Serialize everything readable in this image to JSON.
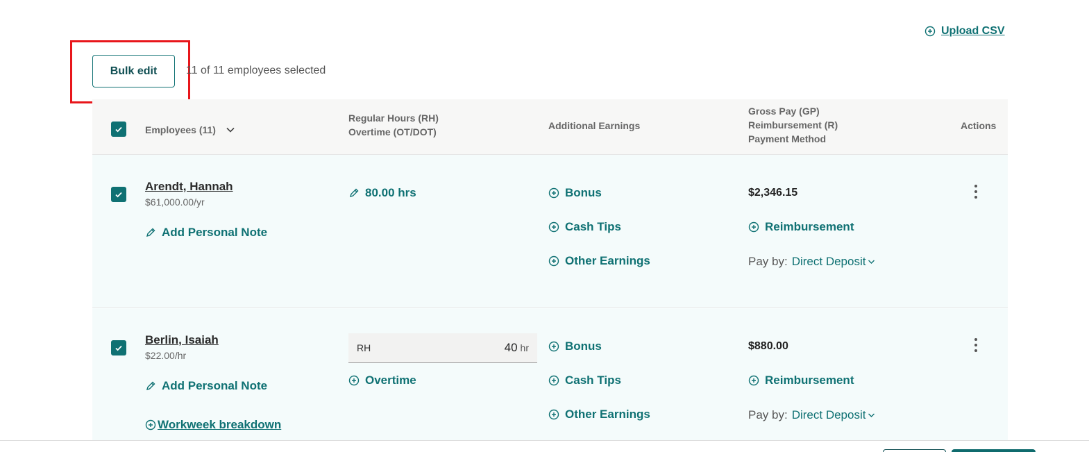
{
  "toolbar": {
    "upload_csv_label": "Upload CSV",
    "bulk_edit_label": "Bulk edit",
    "selection_text": "11 of 11 employees selected"
  },
  "table": {
    "headers": {
      "employees": "Employees (11)",
      "hours_line1": "Regular Hours (RH)",
      "hours_line2": "Overtime (OT/DOT)",
      "additional_earnings": "Additional Earnings",
      "pay_line1": "Gross Pay (GP)",
      "pay_line2": "Reimbursement (R)",
      "pay_line3": "Payment Method",
      "actions": "Actions"
    },
    "rows": [
      {
        "name": "Arendt, Hannah",
        "rate": "$61,000.00/yr",
        "add_note_label": "Add Personal Note",
        "hours_label": "80.00 hrs",
        "earnings": [
          "Bonus",
          "Cash Tips",
          "Other Earnings"
        ],
        "gross_pay": "$2,346.15",
        "reimbursement_label": "Reimbursement",
        "pay_by_label": "Pay by:",
        "payment_method": "Direct Deposit"
      },
      {
        "name": "Berlin, Isaiah",
        "rate": "$22.00/hr",
        "add_note_label": "Add Personal Note",
        "workweek_label": "Workweek breakdown",
        "rh_label": "RH",
        "rh_value": "40",
        "rh_unit": "hr",
        "overtime_label": "Overtime",
        "earnings": [
          "Bonus",
          "Cash Tips",
          "Other Earnings"
        ],
        "gross_pay": "$880.00",
        "reimbursement_label": "Reimbursement",
        "pay_by_label": "Pay by:",
        "payment_method": "Direct Deposit"
      }
    ]
  },
  "colors": {
    "accent": "#0f7173",
    "highlight": "#e8161b",
    "row_background": "#f4fbfb"
  }
}
